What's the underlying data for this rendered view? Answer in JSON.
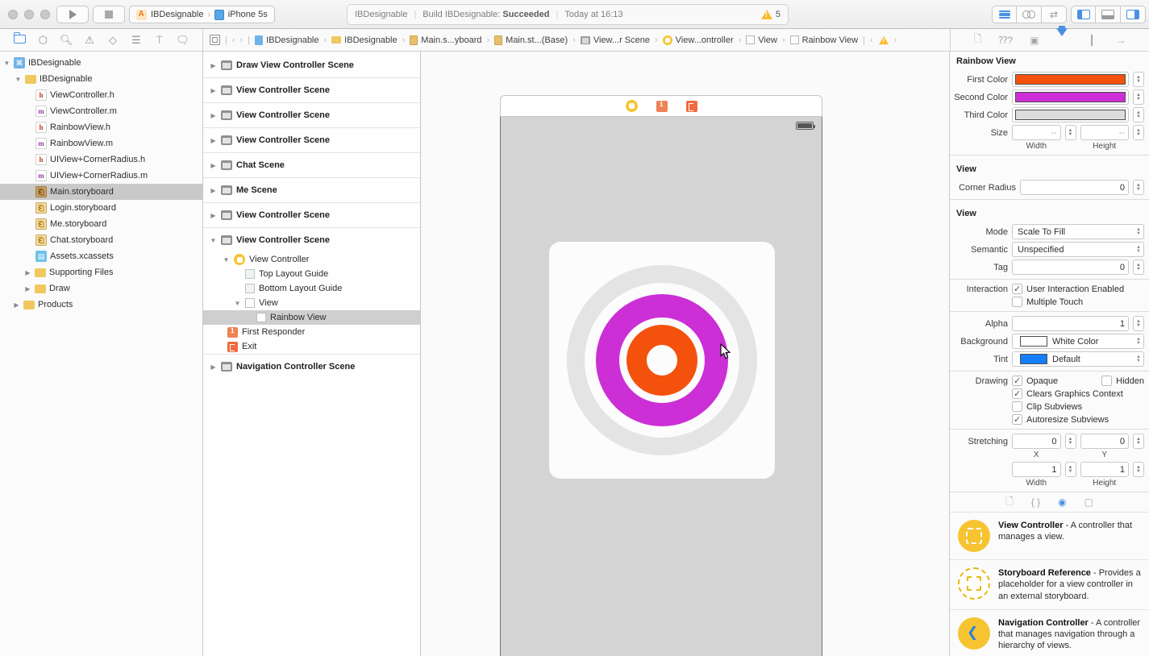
{
  "toolbar": {
    "scheme": {
      "project": "IBDesignable",
      "device": "iPhone 5s"
    },
    "status": {
      "project": "IBDesignable",
      "build_label": "Build IBDesignable:",
      "build_result": "Succeeded",
      "time": "Today at 16:13",
      "warning_count": "5"
    }
  },
  "jumpbar": {
    "items": [
      {
        "label": "IBDesignable",
        "icon": "project-doc"
      },
      {
        "label": "IBDesignable",
        "icon": "folder"
      },
      {
        "label": "Main.s...yboard",
        "icon": "storyboard-doc"
      },
      {
        "label": "Main.st...(Base)",
        "icon": "storyboard-doc"
      },
      {
        "label": "View...r Scene",
        "icon": "scene"
      },
      {
        "label": "View...ontroller",
        "icon": "view-controller"
      },
      {
        "label": "View",
        "icon": "view"
      },
      {
        "label": "Rainbow View",
        "icon": "view"
      }
    ]
  },
  "navigator": {
    "items": [
      {
        "label": "IBDesignable",
        "icon": "project",
        "expanded": true
      },
      {
        "label": "IBDesignable",
        "icon": "folder",
        "expanded": true
      },
      {
        "label": "ViewController.h",
        "icon": "h"
      },
      {
        "label": "ViewController.m",
        "icon": "m"
      },
      {
        "label": "RainbowView.h",
        "icon": "h"
      },
      {
        "label": "RainbowView.m",
        "icon": "m"
      },
      {
        "label": "UIView+CornerRadius.h",
        "icon": "h"
      },
      {
        "label": "UIView+CornerRadius.m",
        "icon": "m"
      },
      {
        "label": "Main.storyboard",
        "icon": "storyboard",
        "selected": true
      },
      {
        "label": "Login.storyboard",
        "icon": "storyboard"
      },
      {
        "label": "Me.storyboard",
        "icon": "storyboard"
      },
      {
        "label": "Chat.storyboard",
        "icon": "storyboard"
      },
      {
        "label": "Assets.xcassets",
        "icon": "assets"
      },
      {
        "label": "Supporting Files",
        "icon": "folder",
        "collapsed": true
      },
      {
        "label": "Draw",
        "icon": "folder",
        "collapsed": true
      },
      {
        "label": "Products",
        "icon": "folder",
        "collapsed": true
      }
    ]
  },
  "outline": {
    "rows": [
      {
        "label": "Draw View Controller Scene"
      },
      {
        "label": "View Controller Scene"
      },
      {
        "label": "View Controller Scene"
      },
      {
        "label": "View Controller Scene"
      },
      {
        "label": "Chat Scene"
      },
      {
        "label": "Me Scene"
      },
      {
        "label": "View Controller Scene"
      },
      {
        "label": "View Controller Scene",
        "expanded": true
      },
      {
        "label": "View Controller",
        "expanded": true
      },
      {
        "label": "Top Layout Guide"
      },
      {
        "label": "Bottom Layout Guide"
      },
      {
        "label": "View",
        "expanded": true
      },
      {
        "label": "Rainbow View",
        "selected": true
      },
      {
        "label": "First Responder"
      },
      {
        "label": "Exit"
      },
      {
        "label": "Navigation Controller Scene"
      }
    ]
  },
  "inspector": {
    "title": "Rainbow View",
    "first_color_label": "First Color",
    "second_color_label": "Second Color",
    "third_color_label": "Third Color",
    "size_label": "Size",
    "size_width_value": "--",
    "size_height_value": "--",
    "width_caption": "Width",
    "height_caption": "Height",
    "view_section_1": "View",
    "corner_radius_label": "Corner Radius",
    "corner_radius_value": "0",
    "view_section_2": "View",
    "mode_label": "Mode",
    "mode_value": "Scale To Fill",
    "semantic_label": "Semantic",
    "semantic_value": "Unspecified",
    "tag_label": "Tag",
    "tag_value": "0",
    "interaction_label": "Interaction",
    "user_interaction_label": "User Interaction Enabled",
    "multiple_touch_label": "Multiple Touch",
    "alpha_label": "Alpha",
    "alpha_value": "1",
    "background_label": "Background",
    "background_value": "White Color",
    "tint_label": "Tint",
    "tint_value": "Default",
    "drawing_label": "Drawing",
    "opaque_label": "Opaque",
    "hidden_label": "Hidden",
    "clears_label": "Clears Graphics Context",
    "clip_label": "Clip Subviews",
    "autoresize_label": "Autoresize Subviews",
    "stretching_label": "Stretching",
    "stretch_x_value": "0",
    "stretch_y_value": "0",
    "stretch_w_value": "1",
    "stretch_h_value": "1",
    "x_caption": "X",
    "y_caption": "Y",
    "checkboxes": {
      "user_interaction": true,
      "multiple_touch": false,
      "opaque": true,
      "hidden": false,
      "clears_graphics_context": true,
      "clip_subviews": false,
      "autoresize_subviews": true
    },
    "colors": {
      "first": "#f4510c",
      "second": "#cc2fd6",
      "third": "#dcdcdc",
      "background_well": "#ffffff",
      "tint_well": "#157efb"
    }
  },
  "library": {
    "items": [
      {
        "name": "View Controller",
        "desc": " - A controller that manages a view."
      },
      {
        "name": "Storyboard Reference",
        "desc": " - Provides a placeholder for a view controller in an external storyboard."
      },
      {
        "name": "Navigation Controller",
        "desc": " - A controller that manages navigation through a hierarchy of views."
      }
    ]
  },
  "canvas_colors": {
    "ring_outer": "#e4e4e4",
    "ring_middle": "#cc2fd6",
    "ring_inner": "#f4510c",
    "screen_bg": "#d4d4d4",
    "card_bg": "#fcfcfc"
  }
}
